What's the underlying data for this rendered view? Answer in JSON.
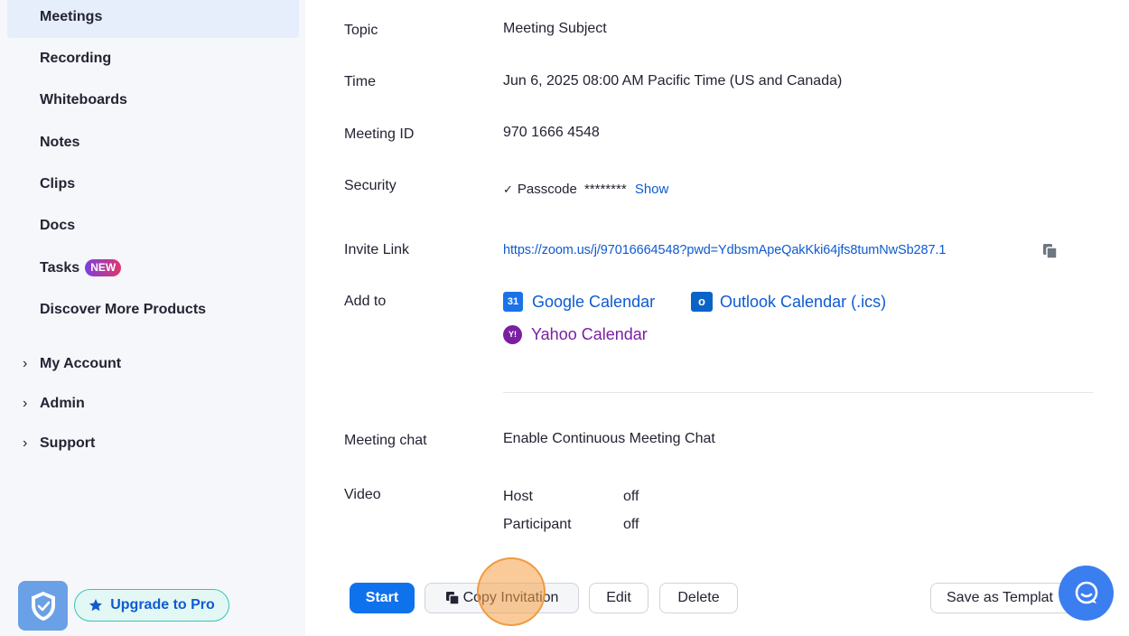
{
  "sidebar": {
    "items": [
      {
        "label": "Meetings",
        "active": true
      },
      {
        "label": "Recording"
      },
      {
        "label": "Whiteboards"
      },
      {
        "label": "Notes"
      },
      {
        "label": "Clips"
      },
      {
        "label": "Docs"
      },
      {
        "label": "Tasks",
        "badge": "NEW"
      },
      {
        "label": "Discover More Products"
      }
    ],
    "expandable": [
      {
        "label": "My Account"
      },
      {
        "label": "Admin"
      },
      {
        "label": "Support"
      }
    ],
    "chevron": "›",
    "upgrade_label": "Upgrade to Pro"
  },
  "details": {
    "topic": {
      "label": "Topic",
      "value": "Meeting Subject"
    },
    "time": {
      "label": "Time",
      "value": "Jun 6, 2025 08:00 AM Pacific Time (US and Canada)"
    },
    "meeting_id": {
      "label": "Meeting ID",
      "value": "970 1666 4548"
    },
    "security": {
      "label": "Security",
      "check": "✓",
      "passcode_label": "Passcode",
      "passcode_masked": "********",
      "show_label": "Show"
    },
    "invite_link": {
      "label": "Invite Link",
      "url": "https://zoom.us/j/97016664548?pwd=YdbsmApeQakKki64jfs8tumNwSb287.1"
    },
    "add_to": {
      "label": "Add to",
      "google": "Google Calendar",
      "outlook": "Outlook Calendar (.ics)",
      "yahoo": "Yahoo Calendar",
      "google_icon_text": "31",
      "outlook_icon_text": "o",
      "yahoo_icon_text": "Y!"
    },
    "meeting_chat": {
      "label": "Meeting chat",
      "value": "Enable Continuous Meeting Chat"
    },
    "video": {
      "label": "Video",
      "host_label": "Host",
      "host_value": "off",
      "participant_label": "Participant",
      "participant_value": "off"
    }
  },
  "actions": {
    "start": "Start",
    "copy_invitation": "Copy Invitation",
    "edit": "Edit",
    "delete": "Delete",
    "save_template": "Save as Templat"
  },
  "colors": {
    "primary": "#0e72ed",
    "link": "#0e5bd0",
    "yahoo": "#7b1fa2",
    "badge_gradient_start": "#7a3fe0",
    "badge_gradient_end": "#e0356b"
  }
}
